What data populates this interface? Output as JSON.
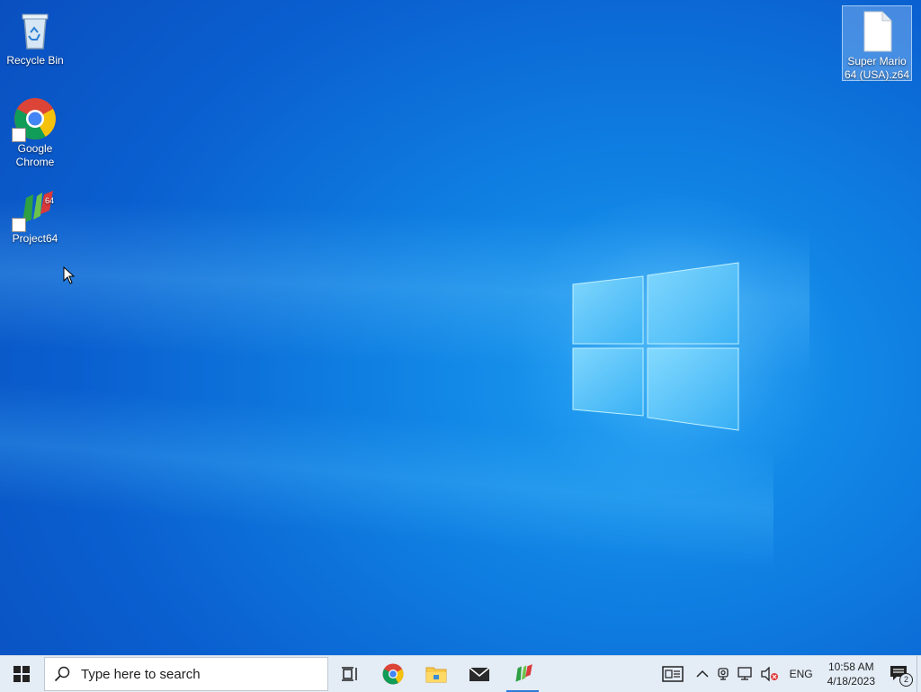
{
  "desktop": {
    "icons": [
      {
        "label": "Recycle Bin",
        "icon": "recycle-bin-icon"
      },
      {
        "label": "Google Chrome",
        "icon": "chrome-icon",
        "shortcut": true
      },
      {
        "label": "Project64",
        "icon": "project64-icon",
        "shortcut": true
      },
      {
        "label": "Super Mario 64 (USA).z64",
        "icon": "file-icon",
        "selected": true
      }
    ]
  },
  "taskbar": {
    "search_placeholder": "Type here to search",
    "pinned": [
      {
        "name": "task-view",
        "icon": "task-view-icon"
      },
      {
        "name": "chrome",
        "icon": "chrome-icon"
      },
      {
        "name": "file-explorer",
        "icon": "folder-icon"
      },
      {
        "name": "mail",
        "icon": "mail-icon"
      },
      {
        "name": "project64",
        "icon": "project64-icon",
        "active": true
      }
    ],
    "tray": {
      "language": "ENG",
      "time": "10:58 AM",
      "date": "4/18/2023",
      "notification_count": "2"
    }
  }
}
